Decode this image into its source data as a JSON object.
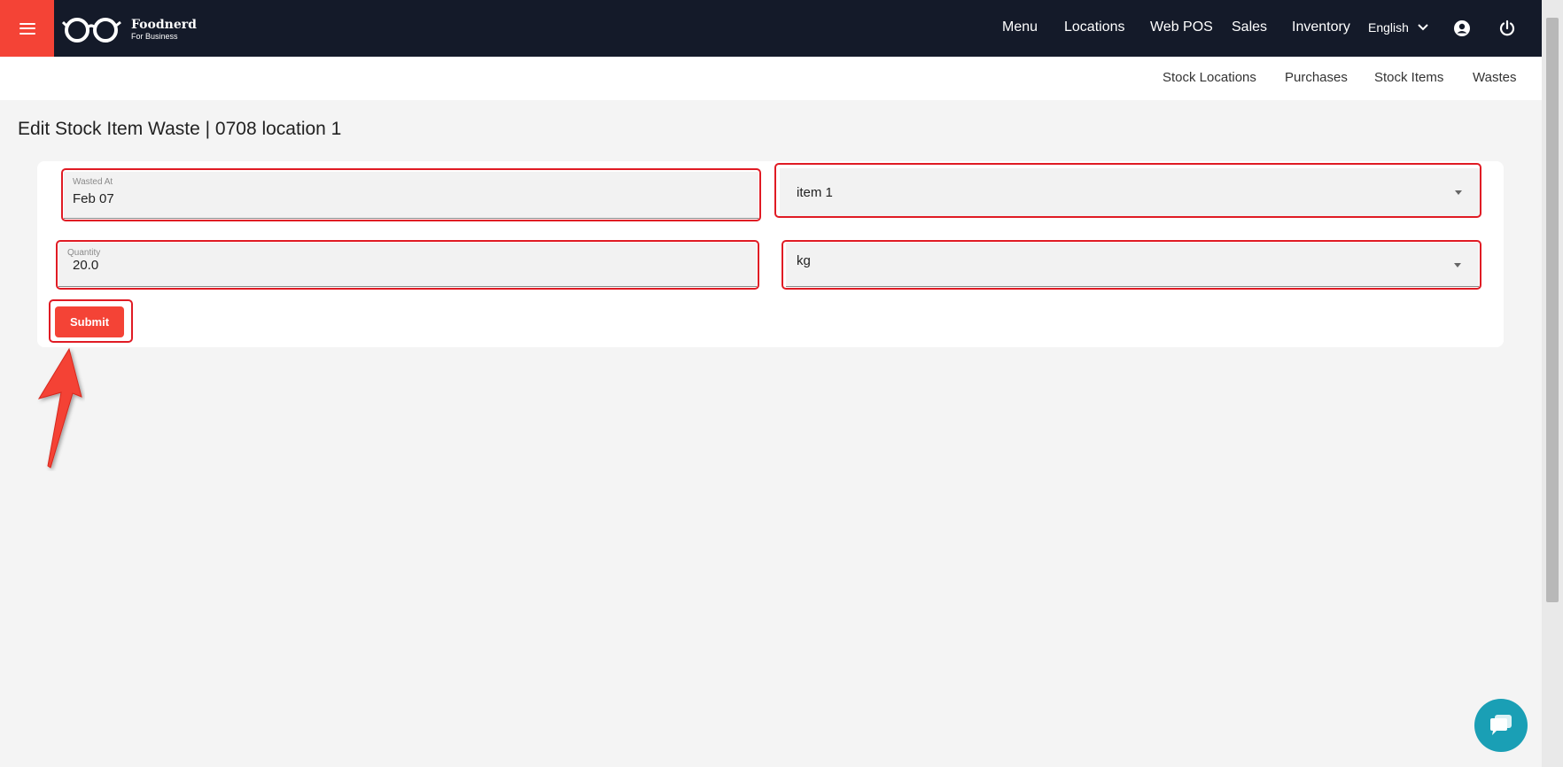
{
  "brand": {
    "name": "Foodnerd",
    "subtitle": "For Business"
  },
  "topnav": {
    "items": [
      "Menu",
      "Locations",
      "Web POS",
      "Sales",
      "Inventory"
    ],
    "language": "English"
  },
  "subnav": {
    "items": [
      "Stock Locations",
      "Purchases",
      "Stock Items",
      "Wastes"
    ]
  },
  "page": {
    "title": "Edit Stock Item Waste | 0708 location 1"
  },
  "form": {
    "wasted_at": {
      "label": "Wasted At",
      "value": "Feb 07"
    },
    "item": {
      "value": "item 1"
    },
    "quantity": {
      "label": "Quantity",
      "value": "20.0"
    },
    "unit": {
      "value": "kg"
    },
    "submit_label": "Submit"
  },
  "colors": {
    "accent": "#f44336",
    "navbar": "#141a29",
    "highlight": "#e01b24",
    "chat": "#1a9fb5"
  }
}
